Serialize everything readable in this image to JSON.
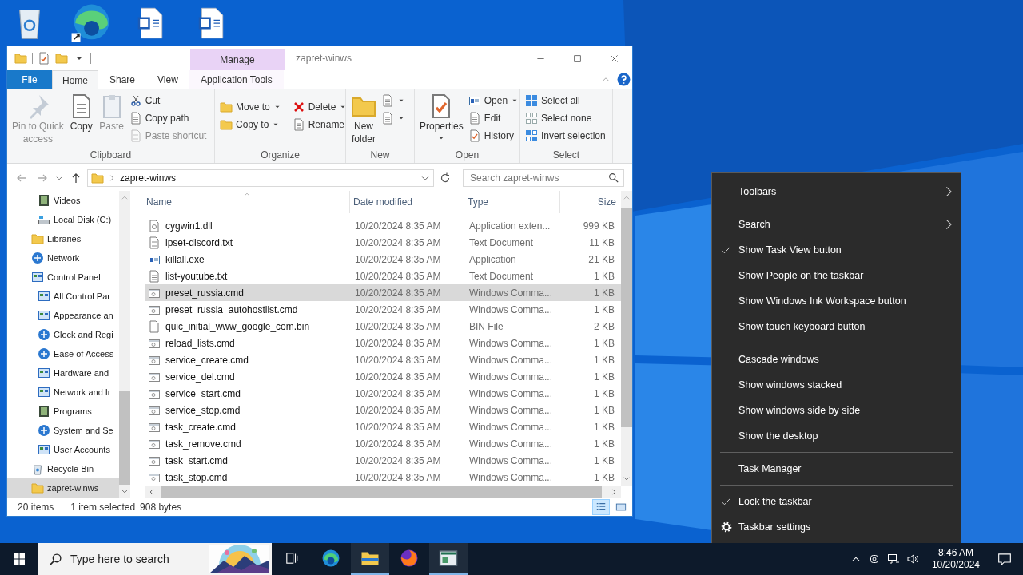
{
  "desktop_icons": [
    {
      "kind": "recycle"
    },
    {
      "kind": "browser"
    },
    {
      "kind": "document"
    },
    {
      "kind": "document"
    }
  ],
  "explorer": {
    "title": "zapret-winws",
    "context_tab": "Manage",
    "tabs": [
      {
        "label": "File",
        "kind": "file",
        "selected": false
      },
      {
        "label": "Home",
        "kind": "tab",
        "selected": true
      },
      {
        "label": "Share",
        "kind": "tab",
        "selected": false
      },
      {
        "label": "View",
        "kind": "tab",
        "selected": false
      },
      {
        "label": "Application Tools",
        "kind": "context",
        "selected": false
      }
    ],
    "ribbon": [
      {
        "label": "Clipboard",
        "columns": [
          [
            {
              "lines": [
                "Pin to Quick",
                "access"
              ],
              "kind": "large",
              "disabled": true,
              "dropdown": false
            }
          ],
          [
            {
              "lines": [
                "Copy"
              ],
              "kind": "large",
              "disabled": false,
              "dropdown": false
            }
          ],
          [
            {
              "lines": [
                "Paste"
              ],
              "kind": "large",
              "disabled": true,
              "dropdown": false
            }
          ],
          [
            {
              "label": "Cut",
              "kind": "small",
              "disabled": false,
              "dropdown": false
            },
            {
              "label": "Copy path",
              "kind": "small",
              "disabled": false,
              "dropdown": false
            },
            {
              "label": "Paste shortcut",
              "kind": "small",
              "disabled": true,
              "dropdown": false
            }
          ]
        ]
      },
      {
        "label": "Organize",
        "columns": [
          [
            {
              "label": "Move to",
              "kind": "small",
              "disabled": false,
              "dropdown": true
            },
            {
              "label": "Copy to",
              "kind": "small",
              "disabled": false,
              "dropdown": true
            }
          ],
          [
            {
              "label": "Delete",
              "kind": "small",
              "disabled": false,
              "dropdown": true
            },
            {
              "label": "Rename",
              "kind": "small",
              "disabled": false,
              "dropdown": false
            }
          ]
        ]
      },
      {
        "label": "New",
        "columns": [
          [
            {
              "lines": [
                "New",
                "folder"
              ],
              "kind": "large",
              "disabled": false,
              "dropdown": false
            }
          ],
          [
            {
              "kind": "icon",
              "disabled": false,
              "dropdown": true
            },
            {
              "kind": "icon",
              "disabled": false,
              "dropdown": true
            }
          ]
        ]
      },
      {
        "label": "Open",
        "columns": [
          [
            {
              "lines": [
                "Properties"
              ],
              "kind": "large",
              "disabled": false,
              "dropdown": true
            }
          ],
          [
            {
              "label": "Open",
              "kind": "small",
              "disabled": false,
              "dropdown": true
            },
            {
              "label": "Edit",
              "kind": "small",
              "disabled": false,
              "dropdown": false
            },
            {
              "label": "History",
              "kind": "small",
              "disabled": false,
              "dropdown": false
            }
          ]
        ]
      },
      {
        "label": "Select",
        "columns": [
          [
            {
              "label": "Select all",
              "kind": "small",
              "disabled": false,
              "dropdown": false
            },
            {
              "label": "Select none",
              "kind": "small",
              "disabled": false,
              "dropdown": false
            },
            {
              "label": "Invert selection",
              "kind": "small",
              "disabled": false,
              "dropdown": false
            }
          ]
        ]
      }
    ],
    "address": {
      "path": "zapret-winws"
    },
    "search": {
      "placeholder": "Search zapret-winws"
    },
    "nav": {
      "items": [
        {
          "children": [
            {
              "label": "Videos",
              "selected": false
            },
            {
              "label": "Local Disk (C:)",
              "selected": false
            }
          ]
        },
        {
          "label": "Libraries",
          "selected": false
        },
        {
          "label": "Network",
          "selected": false
        },
        {
          "label": "Control Panel",
          "selected": false,
          "children": [
            {
              "label": "All Control Par",
              "selected": false
            },
            {
              "label": "Appearance an",
              "selected": false
            },
            {
              "label": "Clock and Regi",
              "selected": false
            },
            {
              "label": "Ease of Access",
              "selected": false
            },
            {
              "label": "Hardware and",
              "selected": false
            },
            {
              "label": "Network and Ir",
              "selected": false
            },
            {
              "label": "Programs",
              "selected": false
            },
            {
              "label": "System and Se",
              "selected": false
            },
            {
              "label": "User Accounts",
              "selected": false
            }
          ]
        },
        {
          "label": "Recycle Bin",
          "selected": false
        },
        {
          "label": "zapret-winws",
          "selected": true
        }
      ]
    },
    "columns": [
      {
        "label": "Name",
        "sorted": true
      },
      {
        "label": "Date modified",
        "sorted": false
      },
      {
        "label": "Type",
        "sorted": false
      },
      {
        "label": "Size",
        "sorted": false
      }
    ],
    "rows": [
      {
        "name": "cygwin1.dll",
        "date": "10/20/2024 8:35 AM",
        "type": "Application exten...",
        "size": "999 KB",
        "kind": "dll",
        "selected": false
      },
      {
        "name": "ipset-discord.txt",
        "date": "10/20/2024 8:35 AM",
        "type": "Text Document",
        "size": "11 KB",
        "kind": "txt",
        "selected": false
      },
      {
        "name": "killall.exe",
        "date": "10/20/2024 8:35 AM",
        "type": "Application",
        "size": "21 KB",
        "kind": "exe",
        "selected": false
      },
      {
        "name": "list-youtube.txt",
        "date": "10/20/2024 8:35 AM",
        "type": "Text Document",
        "size": "1 KB",
        "kind": "txt",
        "selected": false
      },
      {
        "name": "preset_russia.cmd",
        "date": "10/20/2024 8:35 AM",
        "type": "Windows Comma...",
        "size": "1 KB",
        "kind": "cmd",
        "selected": true
      },
      {
        "name": "preset_russia_autohostlist.cmd",
        "date": "10/20/2024 8:35 AM",
        "type": "Windows Comma...",
        "size": "1 KB",
        "kind": "cmd",
        "selected": false
      },
      {
        "name": "quic_initial_www_google_com.bin",
        "date": "10/20/2024 8:35 AM",
        "type": "BIN File",
        "size": "2 KB",
        "kind": "bin",
        "selected": false
      },
      {
        "name": "reload_lists.cmd",
        "date": "10/20/2024 8:35 AM",
        "type": "Windows Comma...",
        "size": "1 KB",
        "kind": "cmd",
        "selected": false
      },
      {
        "name": "service_create.cmd",
        "date": "10/20/2024 8:35 AM",
        "type": "Windows Comma...",
        "size": "1 KB",
        "kind": "cmd",
        "selected": false
      },
      {
        "name": "service_del.cmd",
        "date": "10/20/2024 8:35 AM",
        "type": "Windows Comma...",
        "size": "1 KB",
        "kind": "cmd",
        "selected": false
      },
      {
        "name": "service_start.cmd",
        "date": "10/20/2024 8:35 AM",
        "type": "Windows Comma...",
        "size": "1 KB",
        "kind": "cmd",
        "selected": false
      },
      {
        "name": "service_stop.cmd",
        "date": "10/20/2024 8:35 AM",
        "type": "Windows Comma...",
        "size": "1 KB",
        "kind": "cmd",
        "selected": false
      },
      {
        "name": "task_create.cmd",
        "date": "10/20/2024 8:35 AM",
        "type": "Windows Comma...",
        "size": "1 KB",
        "kind": "cmd",
        "selected": false
      },
      {
        "name": "task_remove.cmd",
        "date": "10/20/2024 8:35 AM",
        "type": "Windows Comma...",
        "size": "1 KB",
        "kind": "cmd",
        "selected": false
      },
      {
        "name": "task_start.cmd",
        "date": "10/20/2024 8:35 AM",
        "type": "Windows Comma...",
        "size": "1 KB",
        "kind": "cmd",
        "selected": false
      },
      {
        "name": "task_stop.cmd",
        "date": "10/20/2024 8:35 AM",
        "type": "Windows Comma...",
        "size": "1 KB",
        "kind": "cmd",
        "selected": false
      }
    ],
    "status_bar": {
      "count": "20 items",
      "selection": "1 item selected",
      "size": "908 bytes"
    },
    "views": [
      {
        "kind": "details",
        "selected": true
      },
      {
        "kind": "tiles",
        "selected": false
      }
    ]
  },
  "context_menu": {
    "sections": [
      [
        {
          "label": "Toolbars",
          "kind": "submenu"
        }
      ],
      [
        {
          "label": "Search",
          "kind": "submenu"
        },
        {
          "label": "Show Task View button",
          "kind": "toggle",
          "checked": true
        },
        {
          "label": "Show People on the taskbar",
          "kind": "toggle",
          "checked": false
        },
        {
          "label": "Show Windows Ink Workspace button",
          "kind": "toggle",
          "checked": false
        },
        {
          "label": "Show touch keyboard button",
          "kind": "toggle",
          "checked": false
        }
      ],
      [
        {
          "label": "Cascade windows",
          "kind": "command"
        },
        {
          "label": "Show windows stacked",
          "kind": "command"
        },
        {
          "label": "Show windows side by side",
          "kind": "command"
        },
        {
          "label": "Show the desktop",
          "kind": "command"
        }
      ],
      [
        {
          "label": "Task Manager",
          "kind": "command"
        }
      ],
      [
        {
          "label": "Lock the taskbar",
          "kind": "toggle",
          "checked": true
        },
        {
          "label": "Taskbar settings",
          "kind": "settings"
        }
      ]
    ]
  },
  "taskbar": {
    "search": {
      "placeholder": "Type here to search"
    },
    "apps": [
      {
        "kind": "taskview",
        "running": false
      },
      {
        "kind": "browser",
        "running": false
      },
      {
        "kind": "files",
        "running": true
      },
      {
        "kind": "fox",
        "running": false
      },
      {
        "kind": "window",
        "running": true
      }
    ],
    "time": "8:46 AM",
    "date": "10/20/2024"
  }
}
